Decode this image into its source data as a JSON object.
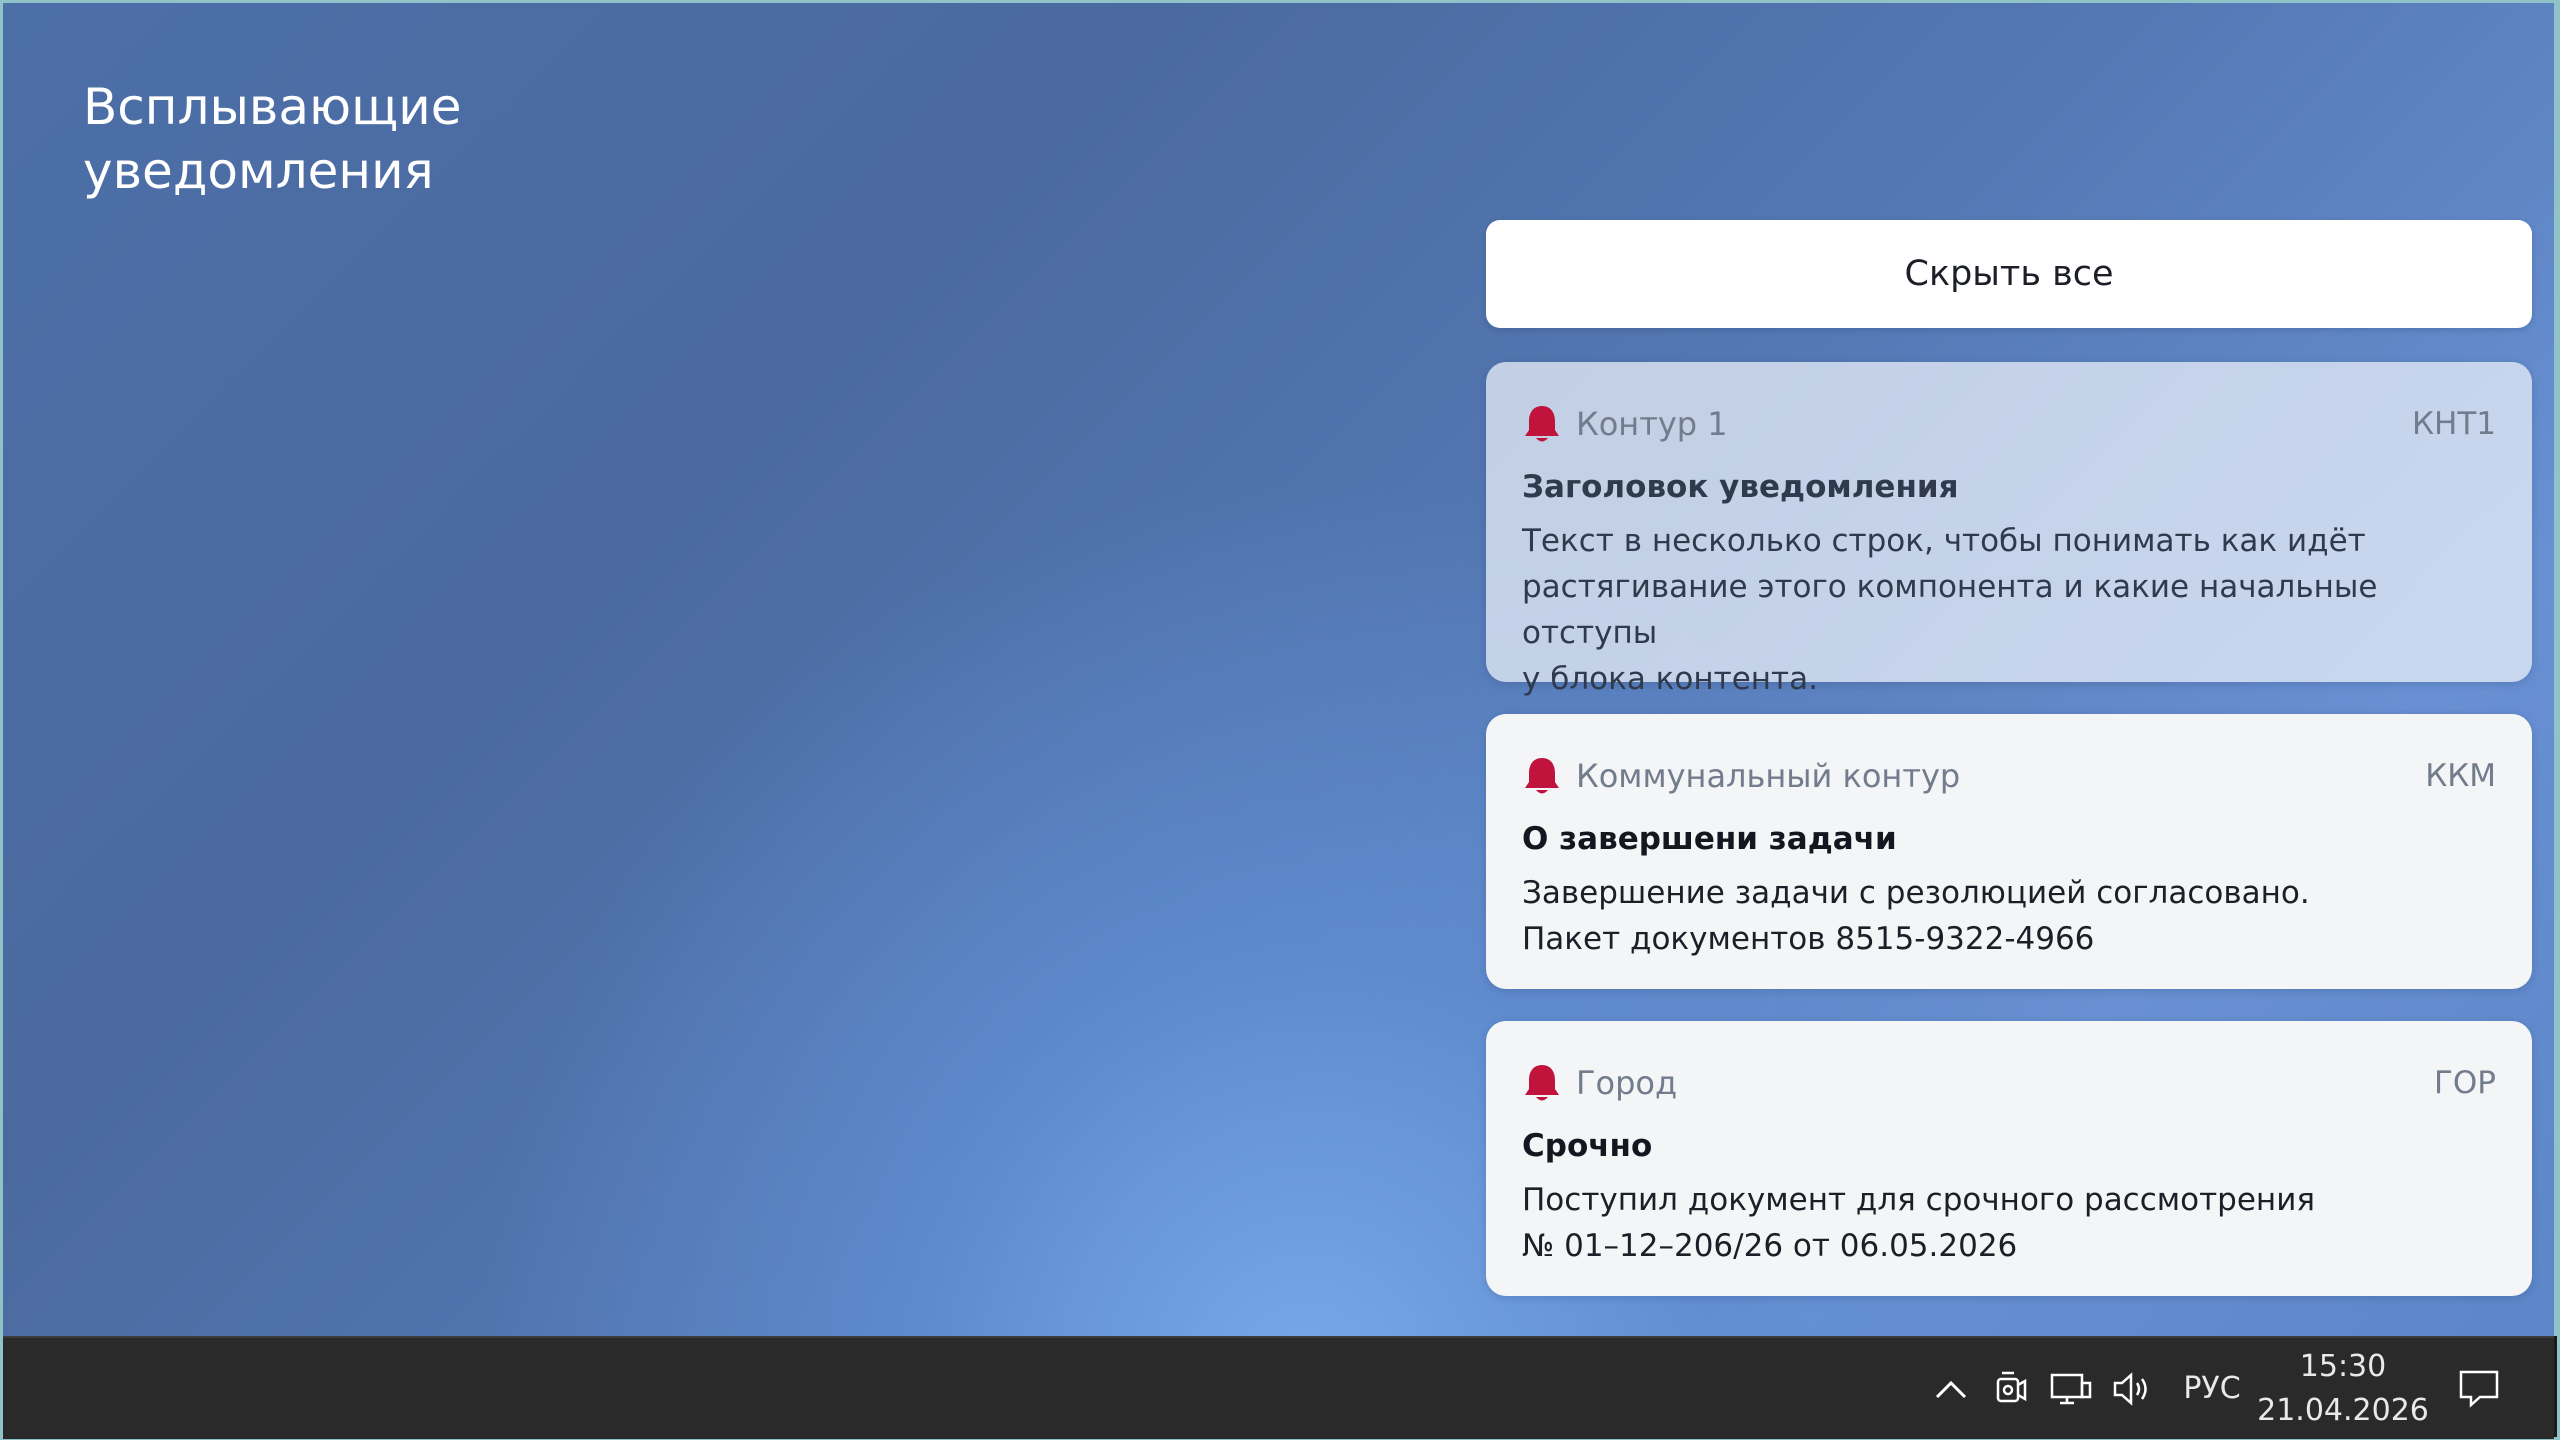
{
  "page": {
    "title_lines": [
      "Всплывающие",
      "уведомления"
    ]
  },
  "actions": {
    "hide_all_label": "Скрыть все"
  },
  "notifications": [
    {
      "source": "Контур 1",
      "code": "КНТ1",
      "title": "Заголовок уведомления",
      "text": "Текст в несколько строк, чтобы понимать как идёт\nрастягивание этого компонента и какие начальные отступы\nу блока контента.",
      "icon": "bell-icon",
      "state": "dimmed"
    },
    {
      "source": "Коммунальный контур",
      "code": "ККМ",
      "title": "О завершени задачи",
      "text": "Завершение задачи с резолюцией согласовано.\nПакет документов 8515-9322-4966",
      "icon": "bell-icon",
      "state": "normal"
    },
    {
      "source": "Город",
      "code": "ГОР",
      "title": "Срочно",
      "text": "Поступил документ для срочного рассмотрения\n№ 01–12–206/26 от 06.05.2026",
      "icon": "bell-icon",
      "state": "normal"
    }
  ],
  "taskbar": {
    "tray_icons": [
      "chevron-up-icon",
      "camera-icon",
      "network-icon",
      "volume-icon"
    ],
    "language": "РУС",
    "time": "15:30",
    "date": "21.04.2026",
    "notification_center_icon": "action-center-icon"
  },
  "colors": {
    "bell": "#c0143c",
    "card_bg": "#f4f5f7",
    "taskbar_bg": "#2b2a2b"
  }
}
